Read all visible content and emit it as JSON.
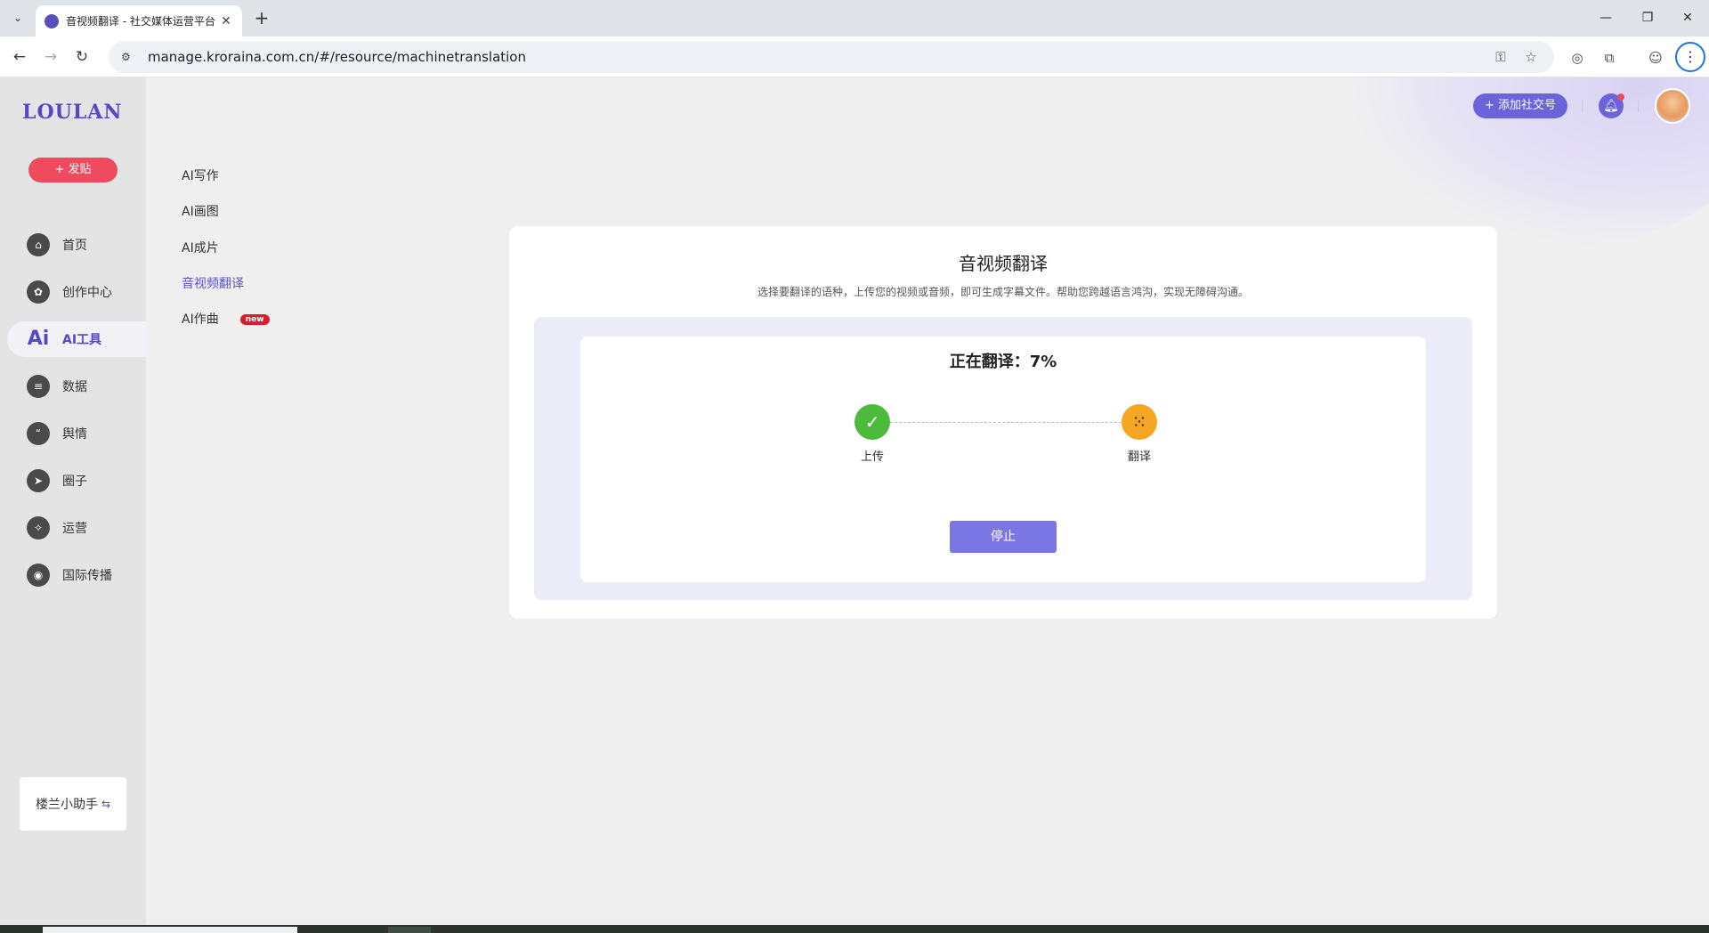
{
  "browser": {
    "tab_title": "音视频翻译 - 社交媒体运营平台",
    "url": "manage.kroraina.com.cn/#/resource/machinetranslation",
    "icons": [
      "tab-dropdown-icon",
      "close-icon",
      "plus-icon",
      "minimize-icon",
      "restore-icon",
      "window-close-icon",
      "back-icon",
      "forward-icon",
      "reload-icon",
      "site-info-icon",
      "key-icon",
      "star-icon",
      "extension-icon",
      "puzzle-icon",
      "profile-icon",
      "menu-icon"
    ]
  },
  "sidebar": {
    "logo": "LOULAN",
    "post_button": "+ 发贴",
    "items": [
      {
        "label": "首页",
        "icon": "home-icon"
      },
      {
        "label": "创作中心",
        "icon": "palette-icon"
      },
      {
        "label": "AI工具",
        "icon": "ai-icon",
        "glyph": "Ai",
        "active": true
      },
      {
        "label": "数据",
        "icon": "database-icon"
      },
      {
        "label": "舆情",
        "icon": "quote-icon"
      },
      {
        "label": "圈子",
        "icon": "compass-icon"
      },
      {
        "label": "运营",
        "icon": "operations-icon"
      },
      {
        "label": "国际传播",
        "icon": "globe-icon"
      }
    ],
    "helper": "楼兰小助手"
  },
  "subnav": {
    "items": [
      {
        "label": "AI写作"
      },
      {
        "label": "AI画图"
      },
      {
        "label": "AI成片"
      },
      {
        "label": "音视频翻译",
        "active": true
      },
      {
        "label": "AI作曲",
        "badge": "new"
      }
    ]
  },
  "topbar": {
    "add_account": "+ 添加社交号",
    "bell_icon": "bell-icon"
  },
  "main": {
    "title": "音视频翻译",
    "description": "选择要翻译的语种，上传您的视频或音频，即可生成字幕文件。帮助您跨越语言鸿沟，实现无障碍沟通。",
    "progress_title": "正在翻译：7%",
    "progress_percent": 7,
    "steps": [
      {
        "label": "上传",
        "status": "done",
        "color": "#4cbb3b"
      },
      {
        "label": "翻译",
        "status": "in-progress",
        "color": "#f5a623"
      }
    ],
    "stop_button": "停止"
  },
  "colors": {
    "accent": "#6b63d9",
    "post_button": "#f04a5e",
    "stop_button": "#7b76e6"
  }
}
